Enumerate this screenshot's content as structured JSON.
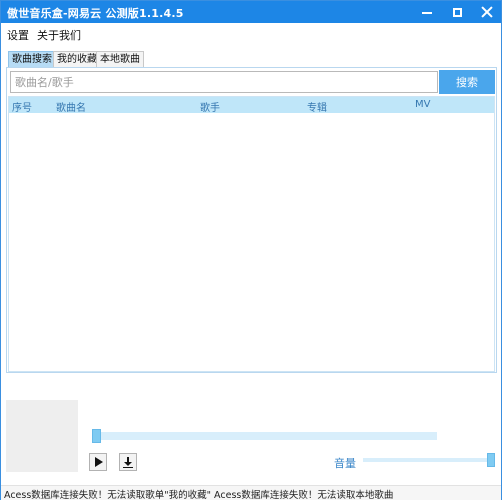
{
  "window": {
    "title": "傲世音乐盒-网易云 公测版1.1.4.5"
  },
  "menu": {
    "settings": "设置",
    "about": "关于我们"
  },
  "tabs": [
    {
      "label": "歌曲搜索",
      "active": true
    },
    {
      "label": "我的收藏",
      "active": false
    },
    {
      "label": "本地歌曲",
      "active": false
    }
  ],
  "search": {
    "placeholder": "歌曲名/歌手",
    "value": "",
    "button_label": "搜索"
  },
  "table": {
    "columns": [
      "序号",
      "歌曲名",
      "歌手",
      "专辑",
      "MV"
    ],
    "rows": []
  },
  "player": {
    "progress": 0,
    "volume_label": "音量",
    "volume": 1.0
  },
  "status": {
    "text": "Acess数据库连接失败！无法读取歌单\"我的收藏\" Acess数据库连接失败！无法读取本地歌曲"
  },
  "colors": {
    "titlebar": "#1d86e6",
    "accent": "#4aa6ec",
    "table_header": "#bfe6f9",
    "active_tab": "#b7dcf5"
  },
  "icons": {
    "minimize": "minimize-icon",
    "maximize": "maximize-icon",
    "close": "close-icon",
    "play": "play-icon",
    "download": "download-icon"
  }
}
